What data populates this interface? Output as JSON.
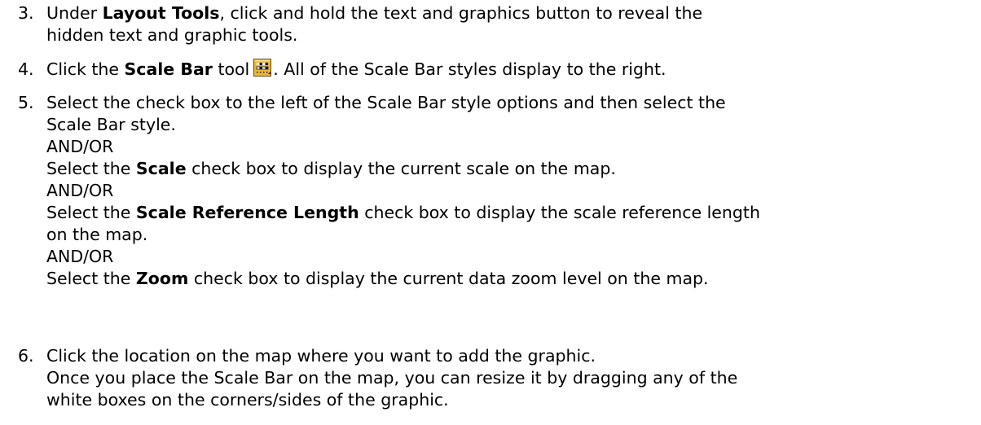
{
  "steps": [
    {
      "number": "3.",
      "lines": [
        {
          "pre": "Under ",
          "bold": "Layout Tools",
          "post": ", click and hold the text and graphics button to reveal the"
        },
        {
          "text": "hidden text and graphic tools."
        }
      ]
    },
    {
      "number": "4.",
      "pre": "Click the ",
      "bold": "Scale Bar",
      "mid": " tool",
      "icon": "scale-bar-tool-icon",
      "post": ". All of the Scale Bar styles display to the right."
    },
    {
      "number": "5.",
      "lines": [
        {
          "text": "Select the check box to the left of the Scale Bar style options and then select the"
        },
        {
          "text": "Scale Bar style."
        },
        {
          "text": "AND/OR"
        },
        {
          "pre": "Select the ",
          "bold": "Scale",
          "post": " check box to display the current scale on the map."
        },
        {
          "text": "AND/OR"
        },
        {
          "pre": "Select the ",
          "bold": "Scale Reference Length",
          "post": " check box to display the scale reference length"
        },
        {
          "text": "on the map."
        },
        {
          "text": "AND/OR"
        },
        {
          "pre": "Select the ",
          "bold": "Zoom",
          "post": " check box to display the current data zoom level on the map."
        }
      ]
    },
    {
      "number": "6.",
      "lines": [
        {
          "text": "Click the location on the map where you want to add the graphic."
        },
        {
          "text": "Once you place the Scale Bar on the map, you can resize it by dragging any of the"
        },
        {
          "text": "white boxes on the corners/sides of the graphic."
        }
      ]
    }
  ]
}
